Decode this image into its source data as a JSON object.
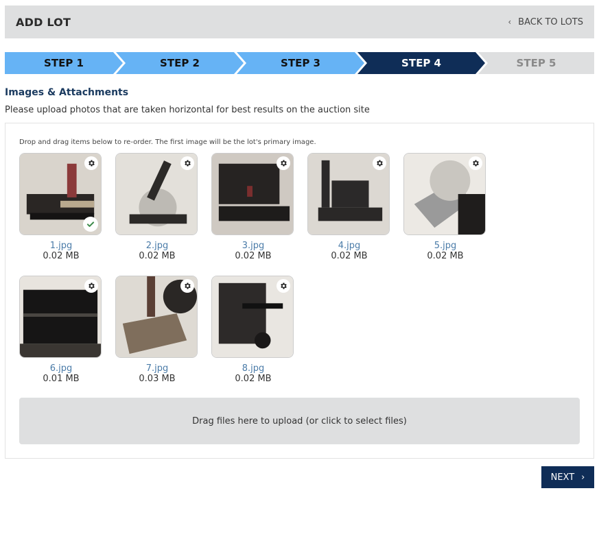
{
  "header": {
    "title": "ADD LOT",
    "back_label": "BACK TO LOTS"
  },
  "steps": [
    {
      "label": "STEP 1",
      "state": "done"
    },
    {
      "label": "STEP 2",
      "state": "done"
    },
    {
      "label": "STEP 3",
      "state": "done"
    },
    {
      "label": "STEP 4",
      "state": "active"
    },
    {
      "label": "STEP 5",
      "state": "pending"
    }
  ],
  "colors": {
    "step_done": "#66b3f5",
    "step_active": "#0f2d57",
    "step_pending": "#dedfe0",
    "accent_dark": "#0f2d57",
    "link": "#4a7ba8",
    "check_green": "#3d8b4a"
  },
  "section": {
    "title": "Images & Attachments",
    "subtitle": "Please upload photos that are taken horizontal for best results on the auction site"
  },
  "panel": {
    "hint": "Drop and drag items below to re-order. The first image will be the lot's primary image.",
    "images": [
      {
        "name": "1.jpg",
        "size": "0.02 MB",
        "primary": true
      },
      {
        "name": "2.jpg",
        "size": "0.02 MB",
        "primary": false
      },
      {
        "name": "3.jpg",
        "size": "0.02 MB",
        "primary": false
      },
      {
        "name": "4.jpg",
        "size": "0.02 MB",
        "primary": false
      },
      {
        "name": "5.jpg",
        "size": "0.02 MB",
        "primary": false
      },
      {
        "name": "6.jpg",
        "size": "0.01 MB",
        "primary": false
      },
      {
        "name": "7.jpg",
        "size": "0.03 MB",
        "primary": false
      },
      {
        "name": "8.jpg",
        "size": "0.02 MB",
        "primary": false
      }
    ],
    "dropzone_label": "Drag files here to upload (or click to select files)"
  },
  "footer": {
    "next_label": "NEXT"
  },
  "icons": {
    "back": "chevron-left-icon",
    "settings": "gear-icon",
    "primary": "check-icon",
    "next": "chevron-right-icon"
  }
}
